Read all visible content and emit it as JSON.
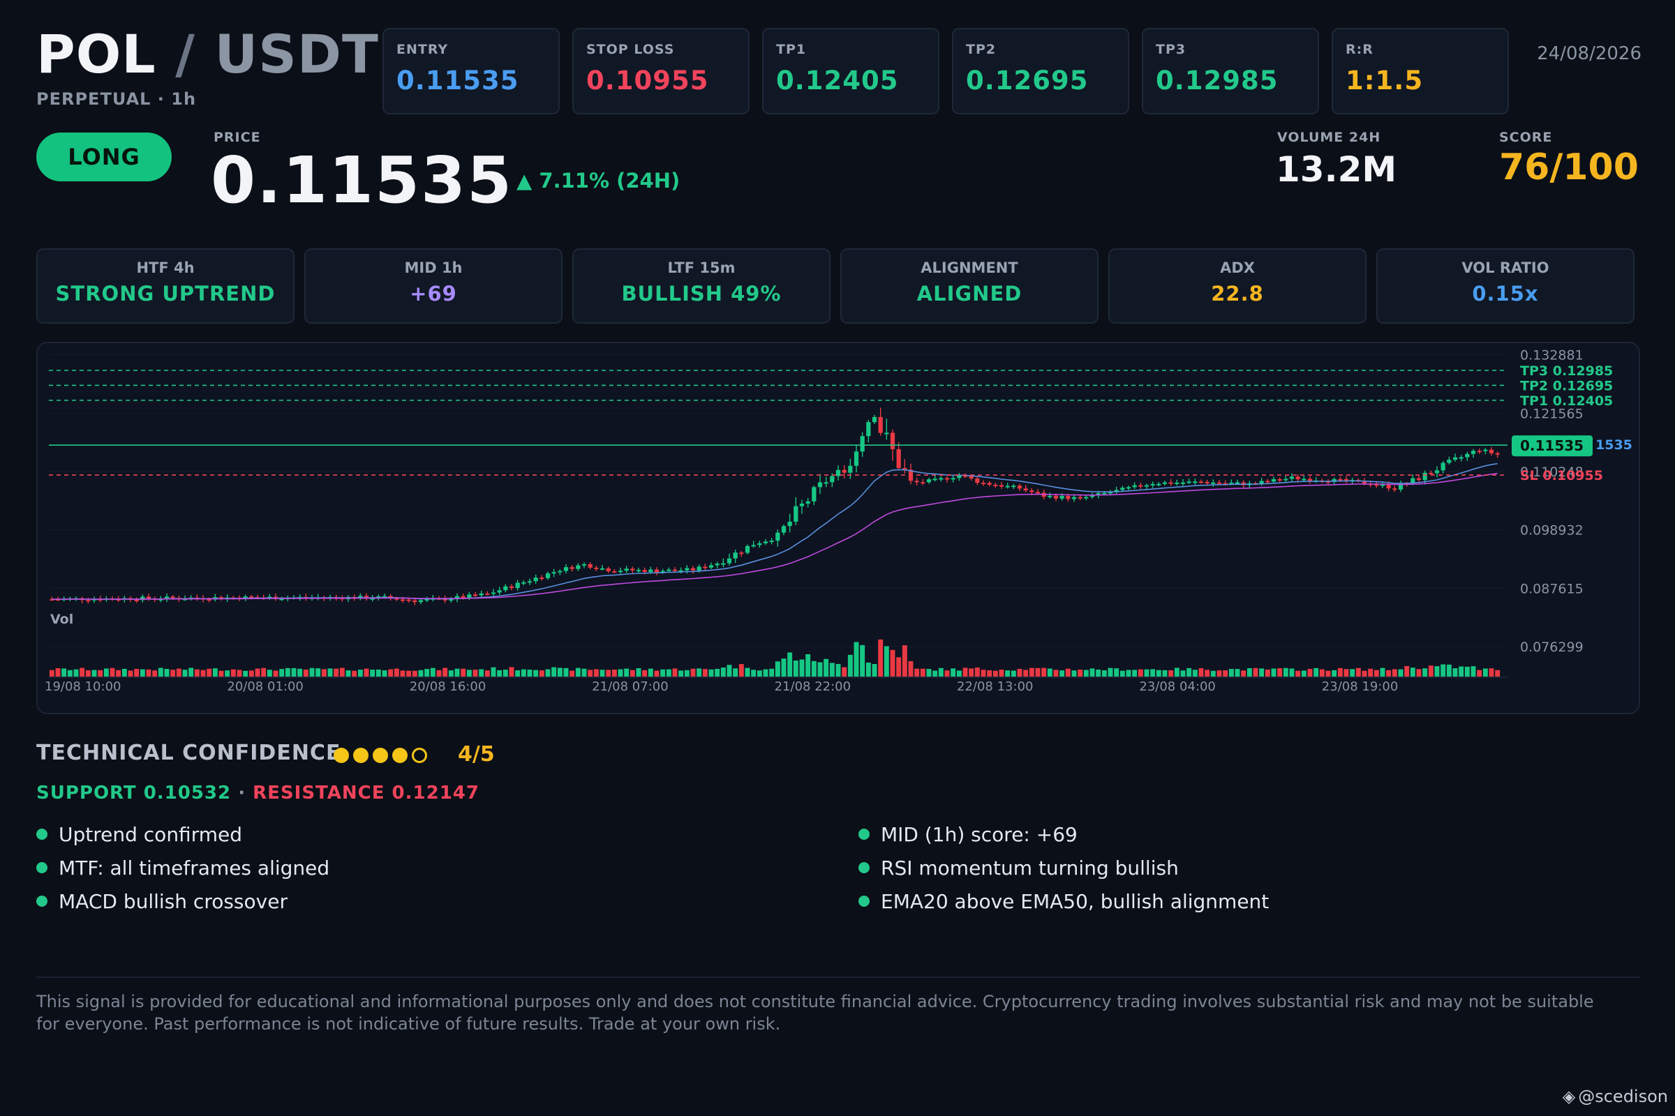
{
  "header": {
    "base": "POL",
    "separator": "/",
    "quote": "USDT",
    "subtitle": "PERPETUAL · 1h",
    "date": "24/08/2026"
  },
  "levels": [
    {
      "label": "ENTRY",
      "value": "0.11535",
      "color": "#4a9df0"
    },
    {
      "label": "STOP LOSS",
      "value": "0.10955",
      "color": "#f0445c"
    },
    {
      "label": "TP1",
      "value": "0.12405",
      "color": "#22c98a"
    },
    {
      "label": "TP2",
      "value": "0.12695",
      "color": "#22c98a"
    },
    {
      "label": "TP3",
      "value": "0.12985",
      "color": "#22c98a"
    },
    {
      "label": "R:R",
      "value": "1:1.5",
      "color": "#f5b51f"
    }
  ],
  "signal": {
    "direction": "LONG",
    "price_label": "PRICE",
    "price": "0.11535",
    "change": "▲ 7.11% (24H)",
    "volume_label": "VOLUME 24H",
    "volume": "13.2M",
    "score_label": "SCORE",
    "score": "76/100"
  },
  "timeframes": [
    {
      "label": "HTF 4h",
      "value": "STRONG UPTREND",
      "color": "#22c98a"
    },
    {
      "label": "MID 1h",
      "value": "+69",
      "color": "#a78bfa"
    },
    {
      "label": "LTF 15m",
      "value": "BULLISH 49%",
      "color": "#22c98a"
    },
    {
      "label": "ALIGNMENT",
      "value": "ALIGNED",
      "color": "#22c98a"
    },
    {
      "label": "ADX",
      "value": "22.8",
      "color": "#f5b51f"
    },
    {
      "label": "VOL RATIO",
      "value": "0.15x",
      "color": "#4a9df0"
    }
  ],
  "chart_data": {
    "type": "candlestick",
    "volume_label": "Vol",
    "y_ticks": [
      "0.132881",
      "0.121565",
      "0.110248",
      "0.098932",
      "0.087615",
      "0.076299"
    ],
    "y_tick_values": [
      0.132881,
      0.121565,
      0.110248,
      0.098932,
      0.087615,
      0.076299
    ],
    "x_ticks": [
      "19/08 10:00",
      "20/08 01:00",
      "20/08 16:00",
      "21/08 07:00",
      "21/08 22:00",
      "22/08 13:00",
      "23/08 04:00",
      "23/08 19:00"
    ],
    "ylim": [
      0.074,
      0.1335
    ],
    "levels": [
      {
        "name": "TP3",
        "value": 0.12985,
        "text": "TP3 0.12985",
        "color": "#22c98a"
      },
      {
        "name": "TP2",
        "value": 0.12695,
        "text": "TP2 0.12695",
        "color": "#22c98a"
      },
      {
        "name": "TP1",
        "value": 0.12405,
        "text": "TP1 0.12405",
        "color": "#22c98a"
      },
      {
        "name": "SL",
        "value": 0.10955,
        "text": "SL 0.10955",
        "color": "#f0445c"
      }
    ],
    "entry": {
      "value": 0.11535,
      "text": "0.11535",
      "trailing_text": "1535"
    },
    "waypoints": [
      [
        0,
        0.0855
      ],
      [
        30,
        0.0858
      ],
      [
        55,
        0.0858
      ],
      [
        60,
        0.0852
      ],
      [
        65,
        0.0855
      ],
      [
        72,
        0.0865
      ],
      [
        78,
        0.0888
      ],
      [
        84,
        0.0912
      ],
      [
        88,
        0.0922
      ],
      [
        92,
        0.0912
      ],
      [
        100,
        0.091
      ],
      [
        106,
        0.0912
      ],
      [
        110,
        0.0925
      ],
      [
        116,
        0.0962
      ],
      [
        120,
        0.0975
      ],
      [
        124,
        0.1035
      ],
      [
        128,
        0.1085
      ],
      [
        132,
        0.1115
      ],
      [
        134,
        0.119
      ],
      [
        136,
        0.1215
      ],
      [
        138,
        0.116
      ],
      [
        142,
        0.108
      ],
      [
        146,
        0.1085
      ],
      [
        150,
        0.1095
      ],
      [
        154,
        0.108
      ],
      [
        160,
        0.107
      ],
      [
        164,
        0.1055
      ],
      [
        170,
        0.105
      ],
      [
        176,
        0.1065
      ],
      [
        182,
        0.108
      ],
      [
        190,
        0.1082
      ],
      [
        198,
        0.1078
      ],
      [
        205,
        0.109
      ],
      [
        212,
        0.1085
      ],
      [
        218,
        0.108
      ],
      [
        222,
        0.107
      ],
      [
        226,
        0.109
      ],
      [
        232,
        0.1125
      ],
      [
        236,
        0.1145
      ],
      [
        240,
        0.1132
      ]
    ]
  },
  "technical": {
    "title": "TECHNICAL CONFIDENCE",
    "score": "4/5",
    "filled": 4,
    "total": 5,
    "support": "SUPPORT 0.10532",
    "separator": "·",
    "resistance": "RESISTANCE 0.12147",
    "points_left": [
      "Uptrend confirmed",
      "MTF: all timeframes aligned",
      "MACD bullish crossover"
    ],
    "points_right": [
      "MID (1h) score: +69",
      "RSI momentum turning bullish",
      "EMA20 above EMA50, bullish alignment"
    ]
  },
  "disclaimer": "This signal is provided for educational and informational purposes only and does not constitute financial advice. Cryptocurrency trading involves substantial risk and may not be suitable for everyone. Past performance is not indicative of future results. Trade at your own risk.",
  "brand": {
    "icon": "binance-diamond-icon",
    "handle": "@scedison"
  }
}
